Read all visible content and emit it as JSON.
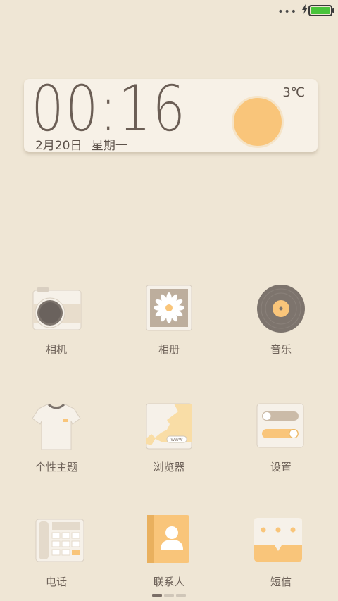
{
  "status_bar": {
    "dots": "•••",
    "icons": [
      "overflow-dots-icon",
      "charging-bolt-icon",
      "battery-icon"
    ],
    "battery_level": 1.0,
    "battery_color": "#48C43B"
  },
  "widget": {
    "time": "00:16",
    "date": "2月20日",
    "weekday": "星期一",
    "temperature": "3℃",
    "weather_icon": "sun-icon"
  },
  "apps": [
    {
      "label": "相机",
      "icon": "camera-icon"
    },
    {
      "label": "相册",
      "icon": "gallery-flower-icon"
    },
    {
      "label": "音乐",
      "icon": "vinyl-record-icon"
    },
    {
      "label": "个性主题",
      "icon": "tshirt-icon"
    },
    {
      "label": "浏览器",
      "icon": "browser-map-icon"
    },
    {
      "label": "设置",
      "icon": "settings-toggles-icon"
    },
    {
      "label": "电话",
      "icon": "phone-keypad-icon"
    },
    {
      "label": "联系人",
      "icon": "contacts-book-icon"
    },
    {
      "label": "短信",
      "icon": "message-bubble-icon"
    }
  ],
  "browser_icon_text": "www",
  "pager": {
    "pages": 3,
    "current": 1
  },
  "colors": {
    "background": "#EFE6D5",
    "accent": "#F9C57A",
    "text": "#6E6259"
  }
}
